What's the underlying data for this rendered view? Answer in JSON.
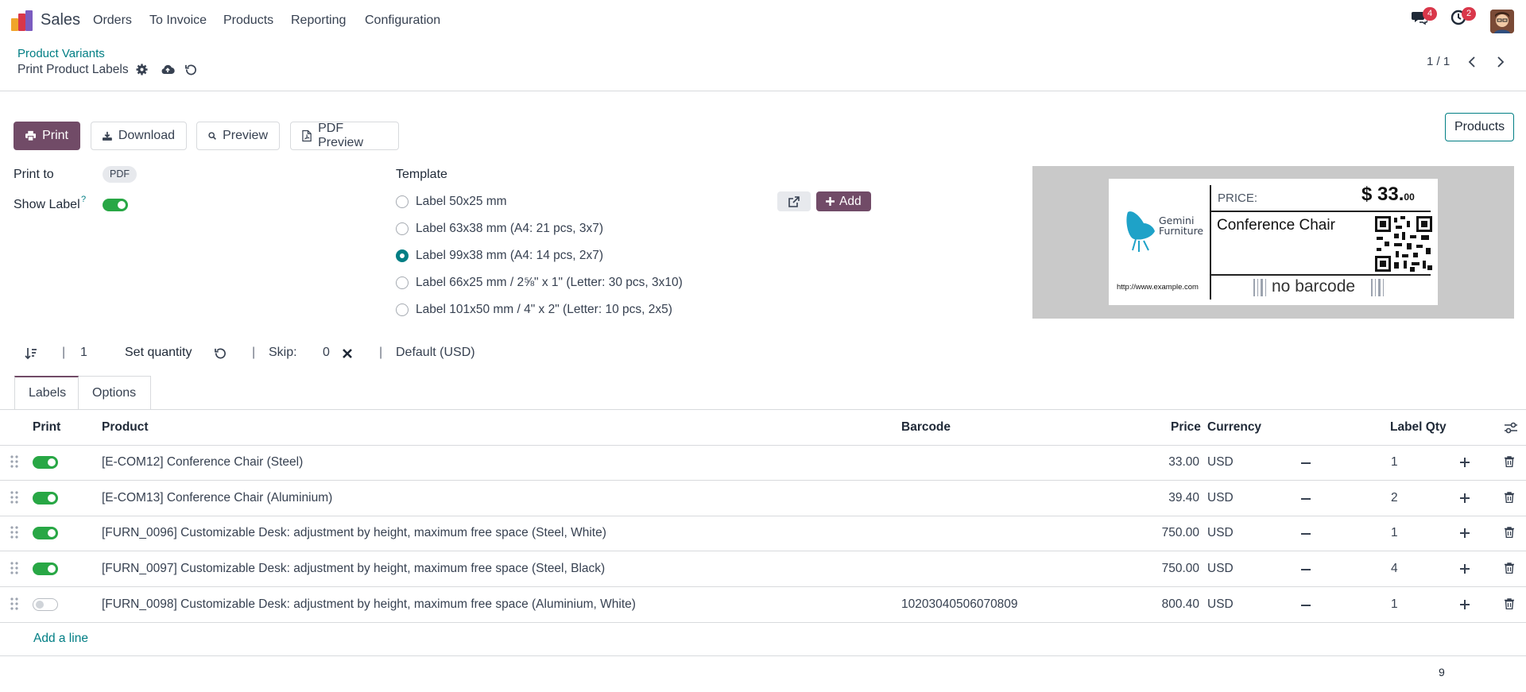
{
  "navbar": {
    "app_name": "Sales",
    "menu": [
      "Orders",
      "To Invoice",
      "Products",
      "Reporting",
      "Configuration"
    ],
    "messages_count": "4",
    "activities_count": "2"
  },
  "control_panel": {
    "breadcrumb": "Product Variants",
    "title": "Print Product Labels",
    "pager": "1 / 1"
  },
  "toolbar": {
    "print": "Print",
    "download": "Download",
    "preview": "Preview",
    "pdf_preview": "PDF Preview",
    "products": "Products"
  },
  "form": {
    "print_to_label": "Print to",
    "print_to_value": "PDF",
    "show_label_label": "Show Label",
    "show_label_help": "?",
    "show_label_on": true,
    "template_label": "Template",
    "templates": [
      {
        "label": "Label 50x25 mm",
        "selected": false
      },
      {
        "label": "Label 63x38 mm (A4: 21 pcs, 3x7)",
        "selected": false
      },
      {
        "label": "Label 99x38 mm (A4: 14 pcs, 2x7)",
        "selected": true
      },
      {
        "label": "Label 66x25 mm / 2⅝\" x 1\" (Letter: 30 pcs, 3x10)",
        "selected": false
      },
      {
        "label": "Label 101x50 mm / 4\" x 2\" (Letter: 10 pcs, 2x5)",
        "selected": false
      }
    ],
    "add_button": "Add"
  },
  "label_preview": {
    "price_label": "PRICE:",
    "price_currency": "$",
    "price_main": "33.",
    "price_cents": "00",
    "product_name": "Conference Chair",
    "url": "http://www.example.com",
    "barcode_text": "no barcode",
    "brand_line1": "Gemini",
    "brand_line2": "Furniture"
  },
  "quantity_bar": {
    "quantity": "1",
    "set_quantity": "Set quantity",
    "skip_label": "Skip:",
    "skip_value": "0",
    "pricelist": "Default (USD)",
    "separator": "|"
  },
  "tabs": [
    "Labels",
    "Options"
  ],
  "table": {
    "columns": {
      "print": "Print",
      "product": "Product",
      "barcode": "Barcode",
      "price": "Price",
      "currency": "Currency",
      "label_qty": "Label Qty"
    },
    "rows": [
      {
        "print": true,
        "product": "[E-COM12] Conference Chair (Steel)",
        "barcode": "",
        "price": "33.00",
        "currency": "USD",
        "qty": "1"
      },
      {
        "print": true,
        "product": "[E-COM13] Conference Chair (Aluminium)",
        "barcode": "",
        "price": "39.40",
        "currency": "USD",
        "qty": "2"
      },
      {
        "print": true,
        "product": "[FURN_0096] Customizable Desk: adjustment by height, maximum free space (Steel, White)",
        "barcode": "",
        "price": "750.00",
        "currency": "USD",
        "qty": "1"
      },
      {
        "print": true,
        "product": "[FURN_0097] Customizable Desk: adjustment by height, maximum free space (Steel, Black)",
        "barcode": "",
        "price": "750.00",
        "currency": "USD",
        "qty": "4"
      },
      {
        "print": false,
        "product": "[FURN_0098] Customizable Desk: adjustment by height, maximum free space (Aluminium, White)",
        "barcode": "10203040506070809",
        "price": "800.40",
        "currency": "USD",
        "qty": "1"
      }
    ],
    "add_line": "Add a line",
    "footer_total": "9"
  },
  "colors": {
    "primary": "#714b67",
    "teal": "#017e84",
    "toggle_on": "#28a745",
    "badge": "#d9374a"
  }
}
